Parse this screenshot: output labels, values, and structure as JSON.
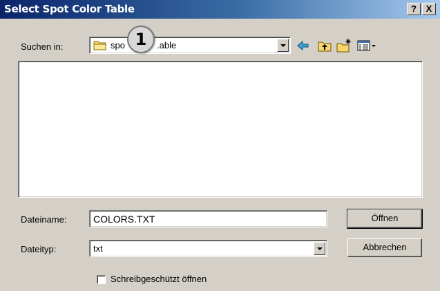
{
  "dialog": {
    "title": "Select Spot Color Table",
    "help_label": "?",
    "close_label": "X"
  },
  "lookin": {
    "label": "Suchen in:",
    "folder_left": "spo",
    "folder_right": ".able"
  },
  "callout": {
    "number": "1"
  },
  "toolbar": {
    "icons": [
      "back-arrow-icon",
      "up-folder-icon",
      "new-folder-icon",
      "view-menu-icon"
    ]
  },
  "filename": {
    "label": "Dateiname:",
    "value": "COLORS.TXT"
  },
  "filetype": {
    "label": "Dateityp:",
    "value": "txt"
  },
  "buttons": {
    "open": "Öffnen",
    "cancel": "Abbrechen"
  },
  "readonly": {
    "label": "Schreibgeschützt öffnen",
    "checked": false
  }
}
